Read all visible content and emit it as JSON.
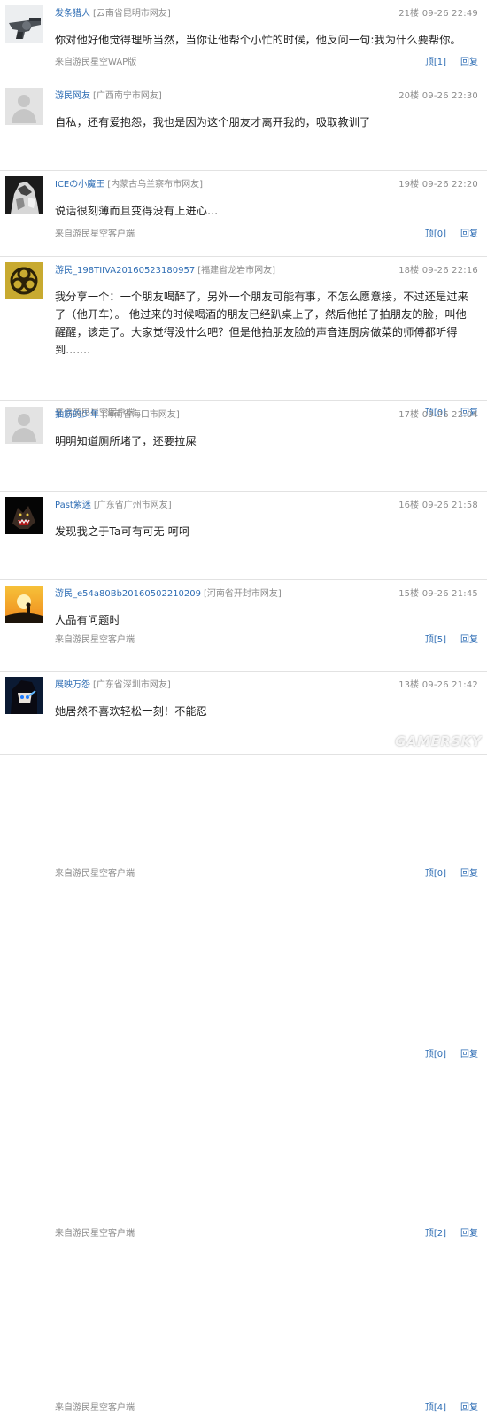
{
  "comments": [
    {
      "username": "发条猎人",
      "location": "[云南省昆明市网友]",
      "floor": "21楼",
      "time": "09-26 22:49",
      "text": "你对他好他觉得理所当然，当你让他帮个小忙的时候，他反问一句:我为什么要帮你。",
      "source": "来自游民星空WAP版",
      "like_label": "顶[1]",
      "reply_label": "回复",
      "avatar_icon": "revolver-avatar-icon"
    },
    {
      "username": "游民网友",
      "location": "[广西南宁市网友]",
      "floor": "20楼",
      "time": "09-26 22:30",
      "text": "自私，还有爱抱怨，我也是因为这个朋友才离开我的，吸取教训了",
      "source": "来自游民星空客户端",
      "like_label": "顶[0]",
      "reply_label": "回复",
      "avatar_icon": "default-user-avatar-icon"
    },
    {
      "username": "ICEの小魔王",
      "location": "[内蒙古乌兰察布市网友]",
      "floor": "19楼",
      "time": "09-26 22:20",
      "text": "说话很刻薄而且变得没有上进心…",
      "source": "来自游民星空客户端",
      "like_label": "顶[0]",
      "reply_label": "回复",
      "avatar_icon": "monochrome-anime-avatar-icon"
    },
    {
      "username": "游民_198TIIVA20160523180957",
      "location": "[福建省龙岩市网友]",
      "floor": "18楼",
      "time": "09-26 22:16",
      "text": "我分享一个：一个朋友喝醉了，另外一个朋友可能有事，不怎么愿意接，不过还是过来了（他开车）。 他过来的时候喝酒的朋友已经趴桌上了，然后他拍了拍朋友的脸，叫他醒醒，该走了。大家觉得没什么吧？但是他拍朋友脸的声音连厨房做菜的师傅都听得到.......",
      "source": "来自游民星空客户端",
      "like_label": "顶[5]",
      "reply_label": "回复",
      "avatar_icon": "biohazard-avatar-icon"
    },
    {
      "username": "抽筋的少年",
      "location": "[海南省海口市网友]",
      "floor": "17楼",
      "time": "09-26 22:04",
      "text": "明明知道厕所堵了，还要拉屎",
      "source": "来自游民星空客户端",
      "like_label": "顶[0]",
      "reply_label": "回复",
      "avatar_icon": "default-user-avatar-icon"
    },
    {
      "username": "Past紫迷",
      "location": "[广东省广州市网友]",
      "floor": "16楼",
      "time": "09-26 21:58",
      "text": "发现我之于Ta可有可无 呵呵",
      "source": "",
      "like_label": "顶[0]",
      "reply_label": "回复",
      "avatar_icon": "snarling-wolf-avatar-icon"
    },
    {
      "username": "游民_e54a80Bb20160502210209",
      "location": "[河南省开封市网友]",
      "floor": "15楼",
      "time": "09-26 21:45",
      "text": "人品有问题时",
      "source": "来自游民星空客户端",
      "like_label": "顶[2]",
      "reply_label": "回复",
      "avatar_icon": "sunset-silhouette-avatar-icon"
    },
    {
      "username": "展映万怨",
      "location": "[广东省深圳市网友]",
      "floor": "13楼",
      "time": "09-26 21:42",
      "text": "她居然不喜欢轻松一刻！不能忍",
      "source": "来自游民星空客户端",
      "like_label": "顶[4]",
      "reply_label": "回复",
      "avatar_icon": "black-rock-shooter-avatar-icon"
    }
  ],
  "watermark": "GAMERSKY",
  "colors": {
    "link": "#2e6db4",
    "meta": "#8c8c8c",
    "divider": "#e2e2e2",
    "text": "#222222"
  }
}
